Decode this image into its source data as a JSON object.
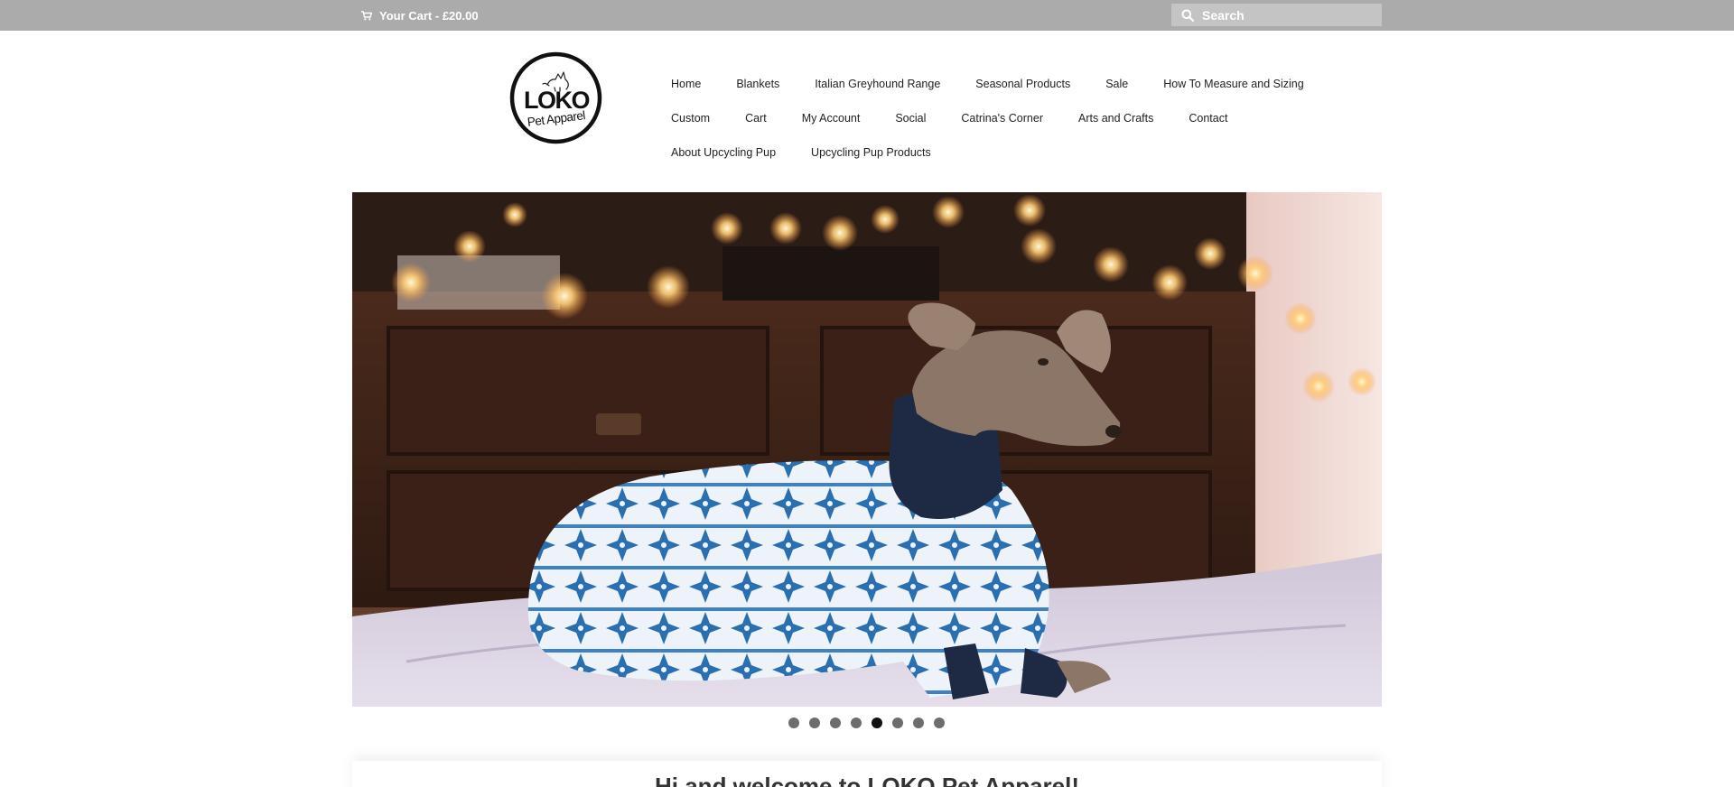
{
  "topbar": {
    "cart_label": "Your Cart - £20.00",
    "search_placeholder": "Search"
  },
  "logo": {
    "brand_main": "LOKO",
    "brand_sub": "Pet Apparel"
  },
  "nav": {
    "rows": [
      [
        "Home",
        "Blankets",
        "Italian Greyhound Range",
        "Seasonal Products",
        "Sale",
        "How To Measure and Sizing"
      ],
      [
        "Custom",
        "Cart",
        "My Account",
        "Social",
        "Catrina's Corner",
        "Arts and Crafts",
        "Contact"
      ],
      [
        "About Upcycling Pup",
        "Upcycling Pup Products"
      ]
    ]
  },
  "slider": {
    "slide_count": 8,
    "active_index": 4
  },
  "welcome": {
    "heading": "Hi and welcome to LOKO Pet Apparel!"
  },
  "colors": {
    "topbar_bg": "#ababab",
    "search_bg": "#c4c4c4",
    "dot_inactive": "#6d6d6d",
    "dot_active": "#111111"
  },
  "icons": {
    "cart": "cart-icon",
    "search": "search-icon"
  }
}
